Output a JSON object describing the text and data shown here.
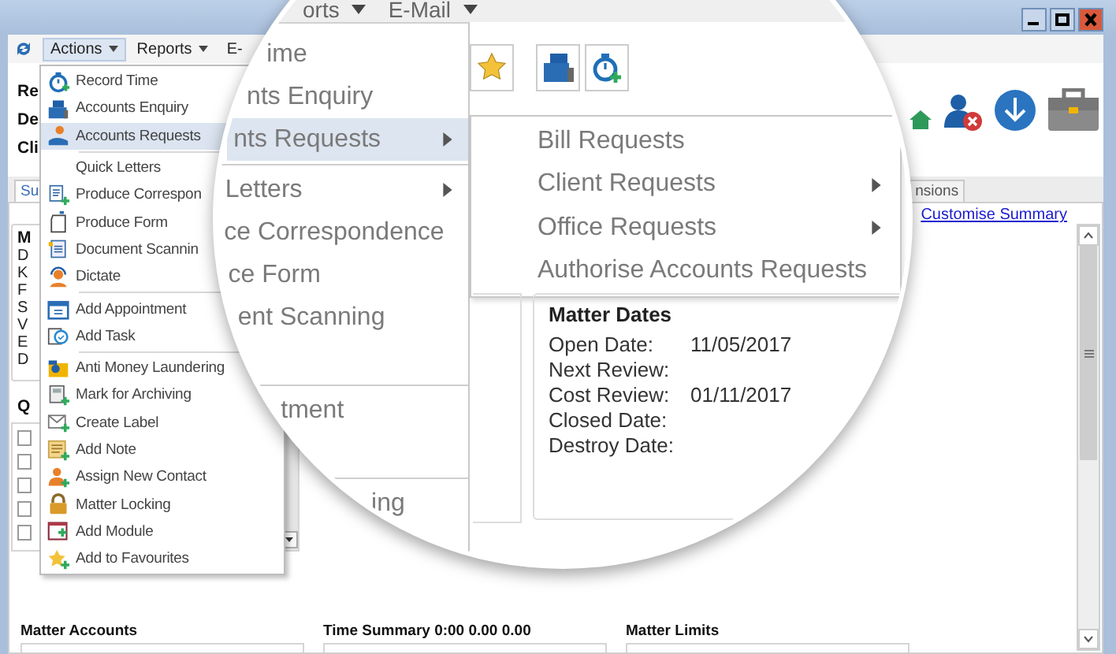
{
  "menubar": [
    {
      "label": "Actions",
      "selected": true,
      "dropdown": true
    },
    {
      "label": "Reports",
      "selected": false,
      "dropdown": true
    },
    {
      "label": "E-",
      "selected": false,
      "dropdown": false
    }
  ],
  "header_labels": [
    "Re",
    "De",
    "Cli"
  ],
  "tabs": [
    {
      "label": "Su",
      "selected": true
    },
    {
      "label": "nsions",
      "selected": false
    }
  ],
  "customise_link": "Customise Summary",
  "summary_box": {
    "heading": "M",
    "lines": [
      "D",
      "K",
      "F",
      "S",
      "V",
      "E",
      "D"
    ]
  },
  "quick_box": {
    "heading": "Q",
    "checkboxes": [
      {
        "checked": false
      },
      {
        "checked": false
      },
      {
        "checked": false
      },
      {
        "checked": false
      },
      {
        "checked": false
      }
    ]
  },
  "group_boxes": [
    "Matter Accounts",
    "Time Summary 0:00 0.00 0.00",
    "Matter Limits"
  ],
  "actions_menu": [
    {
      "kind": "item",
      "label": "Record Time",
      "selected": false
    },
    {
      "kind": "item",
      "label": "Accounts Enquiry",
      "selected": false
    },
    {
      "kind": "item",
      "label": "Accounts Requests",
      "selected": true
    },
    {
      "kind": "separator"
    },
    {
      "kind": "item",
      "label": "Quick Letters",
      "selected": false
    },
    {
      "kind": "item",
      "label": "Produce Correspon",
      "selected": false
    },
    {
      "kind": "item",
      "label": "Produce Form",
      "selected": false
    },
    {
      "kind": "item",
      "label": "Document Scannin",
      "selected": false
    },
    {
      "kind": "item",
      "label": "Dictate",
      "selected": false
    },
    {
      "kind": "separator"
    },
    {
      "kind": "item",
      "label": "Add Appointment",
      "selected": false
    },
    {
      "kind": "item",
      "label": "Add Task",
      "selected": false
    },
    {
      "kind": "separator"
    },
    {
      "kind": "item",
      "label": "Anti Money Laundering",
      "selected": false
    },
    {
      "kind": "item",
      "label": "Mark for Archiving",
      "selected": false
    },
    {
      "kind": "item",
      "label": "Create Label",
      "selected": false
    },
    {
      "kind": "item",
      "label": "Add Note",
      "selected": false
    },
    {
      "kind": "item",
      "label": "Assign New Contact",
      "selected": false
    },
    {
      "kind": "item",
      "label": "Matter Locking",
      "selected": false
    },
    {
      "kind": "item",
      "label": "Add Module",
      "selected": false
    },
    {
      "kind": "item",
      "label": "Add to Favourites",
      "selected": false
    }
  ],
  "magnifier": {
    "menubar": [
      {
        "label": "orts",
        "dropdown": true
      },
      {
        "label": "E-Mail",
        "dropdown": true
      }
    ],
    "menu": [
      {
        "kind": "item",
        "label": "ime",
        "selected": false,
        "submenu": false
      },
      {
        "kind": "item",
        "label": "nts Enquiry",
        "selected": false,
        "submenu": false
      },
      {
        "kind": "item",
        "label": "nts Requests",
        "selected": true,
        "submenu": true
      },
      {
        "kind": "separator"
      },
      {
        "kind": "item",
        "label": "Letters",
        "selected": false,
        "submenu": true
      },
      {
        "kind": "item",
        "label": "ce Correspondence",
        "selected": false,
        "submenu": false
      },
      {
        "kind": "item",
        "label": "ce Form",
        "selected": false,
        "submenu": false
      },
      {
        "kind": "item",
        "label": "ent Scanning",
        "selected": false,
        "submenu": false
      },
      {
        "kind": "blank"
      },
      {
        "kind": "separator"
      },
      {
        "kind": "item",
        "label": "tment",
        "selected": false,
        "submenu": false
      },
      {
        "kind": "blank"
      },
      {
        "kind": "separator"
      },
      {
        "kind": "item",
        "label": "ing",
        "selected": false,
        "submenu": false
      }
    ],
    "submenu": [
      {
        "label": "Bill Requests",
        "submenu": false
      },
      {
        "label": "Client Requests",
        "submenu": true
      },
      {
        "label": "Office Requests",
        "submenu": true
      },
      {
        "label": "Authorise Accounts Requests",
        "submenu": false
      }
    ],
    "matter_dates": {
      "heading": "Matter Dates",
      "rows": [
        {
          "label": "Open Date:",
          "value": "11/05/2017"
        },
        {
          "label": "Next Review:"
        },
        {
          "label": "Cost Review:",
          "value": "01/11/2017"
        },
        {
          "label": "Closed Date:"
        },
        {
          "label": "Destroy Date:"
        }
      ]
    }
  }
}
